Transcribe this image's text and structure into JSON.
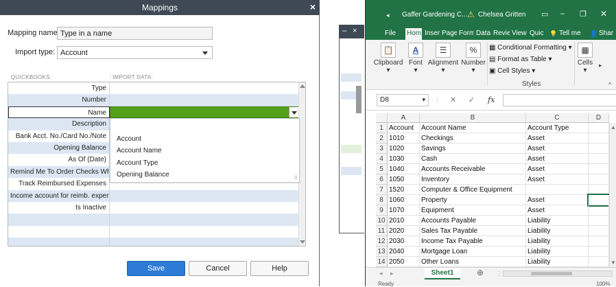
{
  "dialog": {
    "title": "Mappings",
    "close_glyph": "×",
    "mapping_name_label": "Mapping name:",
    "mapping_name_value": "Type in a name",
    "import_type_label": "Import type:",
    "import_type_value": "Account",
    "col_quickbooks": "QUICKBOOKS:",
    "col_import_data": "IMPORT DATA:",
    "rows": [
      {
        "label": "Type"
      },
      {
        "label": "Number"
      },
      {
        "label": "Name"
      },
      {
        "label": "Description"
      },
      {
        "label": "Bank Acct. No./Card No./Note"
      },
      {
        "label": "Opening Balance"
      },
      {
        "label": "As Of (Date)"
      },
      {
        "label": "Remind Me To Order Checks Wh..."
      },
      {
        "label": "Track Reimbursed Expenses"
      },
      {
        "label": "Income account for reimb. expen..."
      },
      {
        "label": "Is Inactive"
      },
      {
        "label": ""
      },
      {
        "label": ""
      },
      {
        "label": ""
      }
    ],
    "dropdown_options": [
      "Account",
      "Account Name",
      "Account Type",
      "Opening Balance"
    ],
    "buttons": {
      "save": "Save",
      "cancel": "Cancel",
      "help": "Help"
    },
    "colors": {
      "titlebar": "#3f4955",
      "selected": "#53a01b",
      "primary": "#2d7bd6"
    }
  },
  "background_window": {
    "minimize_glyph": "–",
    "close_glyph": "×"
  },
  "excel": {
    "title": "Gaffer Gardening C...",
    "user": "Chelsea Gritten",
    "tabs": [
      "File",
      "Hom",
      "Inser",
      "Page",
      "Form",
      "Data",
      "Revie",
      "View",
      "Quic",
      "Tell me",
      "Shar"
    ],
    "ribbon": {
      "clipboard": "Clipboard",
      "font": "Font",
      "alignment": "Alignment",
      "number": "Number",
      "conditional_formatting": "Conditional Formatting",
      "format_as_table": "Format as Table",
      "cell_styles": "Cell Styles",
      "styles_group": "Styles",
      "cells": "Cells"
    },
    "name_box": "D8",
    "formula_icon": "fx",
    "columns": [
      "A",
      "B",
      "C",
      "D"
    ],
    "rows": [
      [
        "Account",
        "Account Name",
        "Account Type"
      ],
      [
        "1010",
        "Checkings",
        "Asset"
      ],
      [
        "1020",
        "Savings",
        "Asset"
      ],
      [
        "1030",
        "Cash",
        "Asset"
      ],
      [
        "1040",
        "Accounts Receivable",
        "Asset"
      ],
      [
        "1050",
        "Inventory",
        "Asset"
      ],
      [
        "1520",
        "Computer & Office Equipment",
        ""
      ],
      [
        "1060",
        "Property",
        "Asset"
      ],
      [
        "1070",
        "Equipment",
        "Asset"
      ],
      [
        "2010",
        "Accounts Payable",
        "Liability"
      ],
      [
        "2020",
        "Sales Tax Payable",
        "Liability"
      ],
      [
        "2030",
        "Income Tax Payable",
        "Liability"
      ],
      [
        "2040",
        "Mortgage Loan",
        "Liability"
      ],
      [
        "2050",
        "Other Loans",
        "Liability"
      ]
    ],
    "sheet_tab": "Sheet1",
    "status": "Ready",
    "zoom": "100%",
    "colors": {
      "brand": "#217346"
    }
  }
}
